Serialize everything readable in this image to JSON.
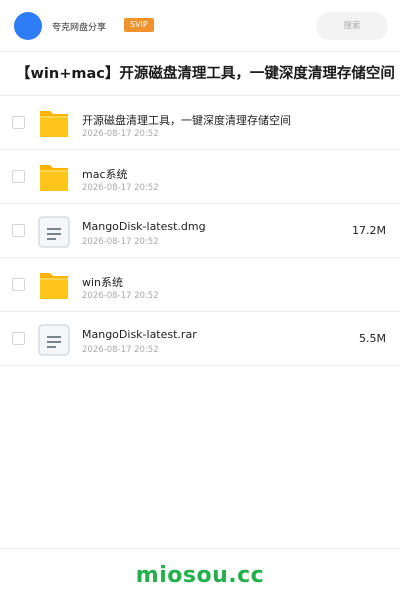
{
  "header": {
    "brand": "夸克网盘分享",
    "badge": "SVIP",
    "search_placeholder": "搜索"
  },
  "share": {
    "title": "【win+mac】开源磁盘清理工具，一键深度清理存储空间"
  },
  "files": [
    {
      "name": "开源磁盘清理工具，一键深度清理存储空间",
      "date": "2026-08-17 20:52",
      "size": "",
      "icon": "folder-icon"
    },
    {
      "name": "mac系统",
      "date": "2026-08-17 20:52",
      "size": "",
      "icon": "folder-icon"
    },
    {
      "name": "MangoDisk-latest.dmg",
      "date": "2026-08-17 20:52",
      "size": "17.2M",
      "icon": "file-icon"
    },
    {
      "name": "win系统",
      "date": "2026-08-17 20:52",
      "size": "",
      "icon": "folder-icon"
    },
    {
      "name": "MangoDisk-latest.rar",
      "date": "2026-08-17 20:52",
      "size": "5.5M",
      "icon": "file-icon"
    }
  ],
  "footer": {
    "brand": "miosou.cc"
  },
  "colors": {
    "accent": "#2e7cf6",
    "badge": "#f0932e",
    "folder": "#ffc51a",
    "footer_brand": "#21b04b"
  }
}
